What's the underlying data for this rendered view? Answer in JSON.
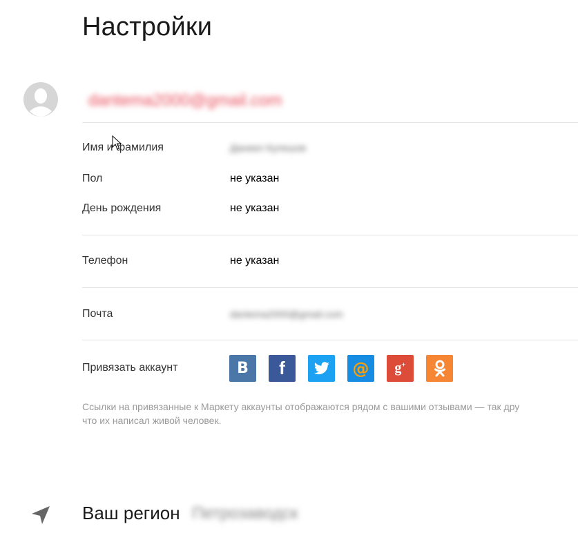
{
  "page": {
    "title": "Настройки"
  },
  "profile": {
    "email": "dantema2000@gmail.com"
  },
  "fields": {
    "name_label": "Имя и фамилия",
    "name_value": "Даниил Кулешов",
    "gender_label": "Пол",
    "gender_value": "не указан",
    "birthday_label": "День рождения",
    "birthday_value": "не указан",
    "phone_label": "Телефон",
    "phone_value": "не указан",
    "mail_label": "Почта",
    "mail_value": "dantema2000@gmail.com",
    "link_label": "Привязать аккаунт"
  },
  "social": [
    {
      "name": "vk-icon",
      "glyph": "B",
      "color": "#4a76a8"
    },
    {
      "name": "facebook-icon",
      "glyph": "f",
      "color": "#3b5998"
    },
    {
      "name": "twitter-icon",
      "glyph": "t",
      "color": "#1da1f2"
    },
    {
      "name": "mailru-icon",
      "glyph": "@",
      "color": "#168de2"
    },
    {
      "name": "google-plus-icon",
      "glyph": "g+",
      "color": "#dd4b39"
    },
    {
      "name": "odnoklassniki-icon",
      "glyph": "ok",
      "color": "#f68634"
    }
  ],
  "note": {
    "line1": "Ссылки на привязанные к Маркету аккаунты отображаются рядом с вашими отзывами — так дру",
    "line2": "что их написал живой человек."
  },
  "region": {
    "title": "Ваш регион",
    "value": "Петрозаводск"
  },
  "colors": {
    "accent_red": "#e74c5a",
    "muted_text": "#999999",
    "divider": "#e6e6e6"
  }
}
